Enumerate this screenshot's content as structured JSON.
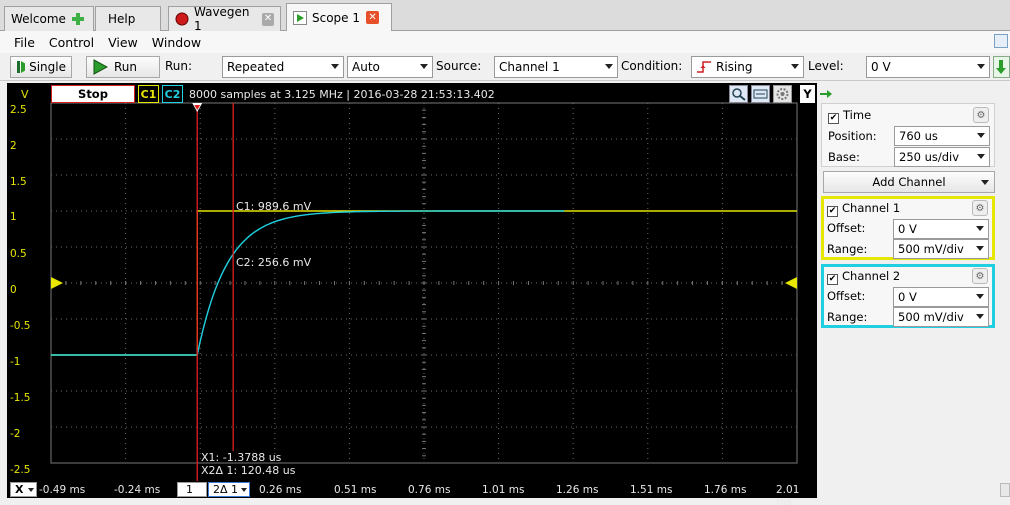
{
  "tabs": [
    {
      "label": "Welcome",
      "icon": "plus-icon"
    },
    {
      "label": "Help"
    },
    {
      "label": "Wavegen 1",
      "icon": "record-icon"
    },
    {
      "label": "Scope 1",
      "icon": "play-icon"
    }
  ],
  "menu": [
    "File",
    "Control",
    "View",
    "Window"
  ],
  "toolbar": {
    "single_label": "Single",
    "run_label": "Run",
    "run_mode_label": "Run:",
    "run_mode_value": "Repeated",
    "trigger_mode_value": "Auto",
    "source_label": "Source:",
    "source_value": "Channel 1",
    "condition_label": "Condition:",
    "condition_value": "Rising",
    "level_label": "Level:",
    "level_value": "0 V"
  },
  "scope": {
    "unit": "V",
    "stop_label": "Stop",
    "c1_label": "C1",
    "c2_label": "C2",
    "info": "8000 samples at 3.125 MHz | 2016-03-28 21:53:13.402",
    "y_button": "Y",
    "y_ticks": [
      "2.5",
      "2",
      "1.5",
      "1",
      "0.5",
      "0",
      "-0.5",
      "-1",
      "-1.5",
      "-2",
      "-2.5"
    ],
    "x_ticks": [
      "-0.49 ms",
      "-0.24 ms",
      "",
      "0.26 ms",
      "0.51 ms",
      "0.76 ms",
      "1.01 ms",
      "1.26 ms",
      "1.51 ms",
      "1.76 ms",
      "2.01 ms"
    ],
    "x_axis_button": "X",
    "cursor_select": "1",
    "cursor_delta": "2Δ 1",
    "c1_readout": "C1: 989.6 mV",
    "c2_readout": "C2: 256.6 mV",
    "x1_readout": "X1: -1.3788 us",
    "x2_readout": "X2Δ 1: 120.48 us",
    "c1_color": "#e6e600",
    "c2_color": "#20d0e0",
    "cursor_color": "#e02020"
  },
  "panel": {
    "time_label": "Time",
    "position_label": "Position:",
    "position_value": "760 us",
    "base_label": "Base:",
    "base_value": "250 us/div",
    "add_channel_label": "Add Channel",
    "ch1_label": "Channel 1",
    "ch1_offset_label": "Offset:",
    "ch1_offset_value": "0 V",
    "ch1_range_label": "Range:",
    "ch1_range_value": "500 mV/div",
    "ch2_label": "Channel 2",
    "ch2_offset_label": "Offset:",
    "ch2_offset_value": "0 V",
    "ch2_range_label": "Range:",
    "ch2_range_value": "500 mV/div"
  }
}
